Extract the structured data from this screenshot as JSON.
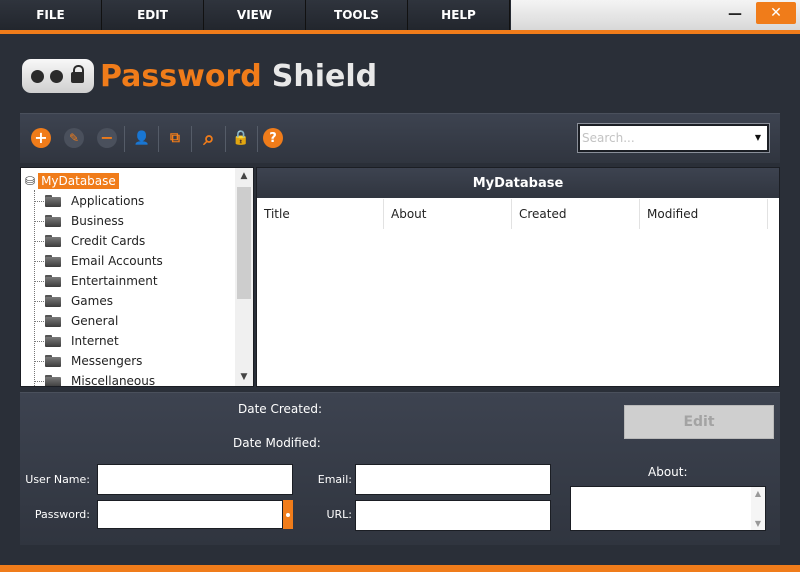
{
  "menu": {
    "items": [
      {
        "label": "FILE"
      },
      {
        "label": "EDIT"
      },
      {
        "label": "VIEW"
      },
      {
        "label": "TOOLS"
      },
      {
        "label": "HELP"
      }
    ]
  },
  "window": {
    "minimize_glyph": "—",
    "close_glyph": "✕"
  },
  "logo": {
    "word1": "Password",
    "word2": "Shield"
  },
  "toolbar": {
    "buttons": [
      {
        "name": "add-icon",
        "glyph": "+"
      },
      {
        "name": "edit-icon",
        "glyph": "✎"
      },
      {
        "name": "remove-icon",
        "glyph": "−"
      },
      {
        "name": "user-icon",
        "glyph": "👤"
      },
      {
        "name": "copy-icon",
        "glyph": "⧉"
      },
      {
        "name": "search-icon",
        "glyph": "⌕"
      },
      {
        "name": "lock-icon",
        "glyph": "🔒"
      },
      {
        "name": "help-icon",
        "glyph": "?"
      }
    ],
    "search_placeholder": "Search...",
    "search_value": "",
    "dropdown_glyph": "▼"
  },
  "tree": {
    "root": "MyDatabase",
    "items": [
      "Applications",
      "Business",
      "Credit Cards",
      "Email Accounts",
      "Entertainment",
      "Games",
      "General",
      "Internet",
      "Messengers",
      "Miscellaneous"
    ]
  },
  "list": {
    "title": "MyDatabase",
    "columns": [
      "Title",
      "About",
      "Created",
      "Modified"
    ]
  },
  "details": {
    "date_created_label": "Date Created:",
    "date_modified_label": "Date Modified:",
    "username_label": "User Name:",
    "password_label": "Password:",
    "email_label": "Email:",
    "url_label": "URL:",
    "about_label": "About:",
    "edit_label": "Edit",
    "username_value": "",
    "password_value": "",
    "email_value": "",
    "url_value": ""
  },
  "colors": {
    "accent": "#f07c1a",
    "panel": "#30353f",
    "background": "#2a2f38"
  }
}
